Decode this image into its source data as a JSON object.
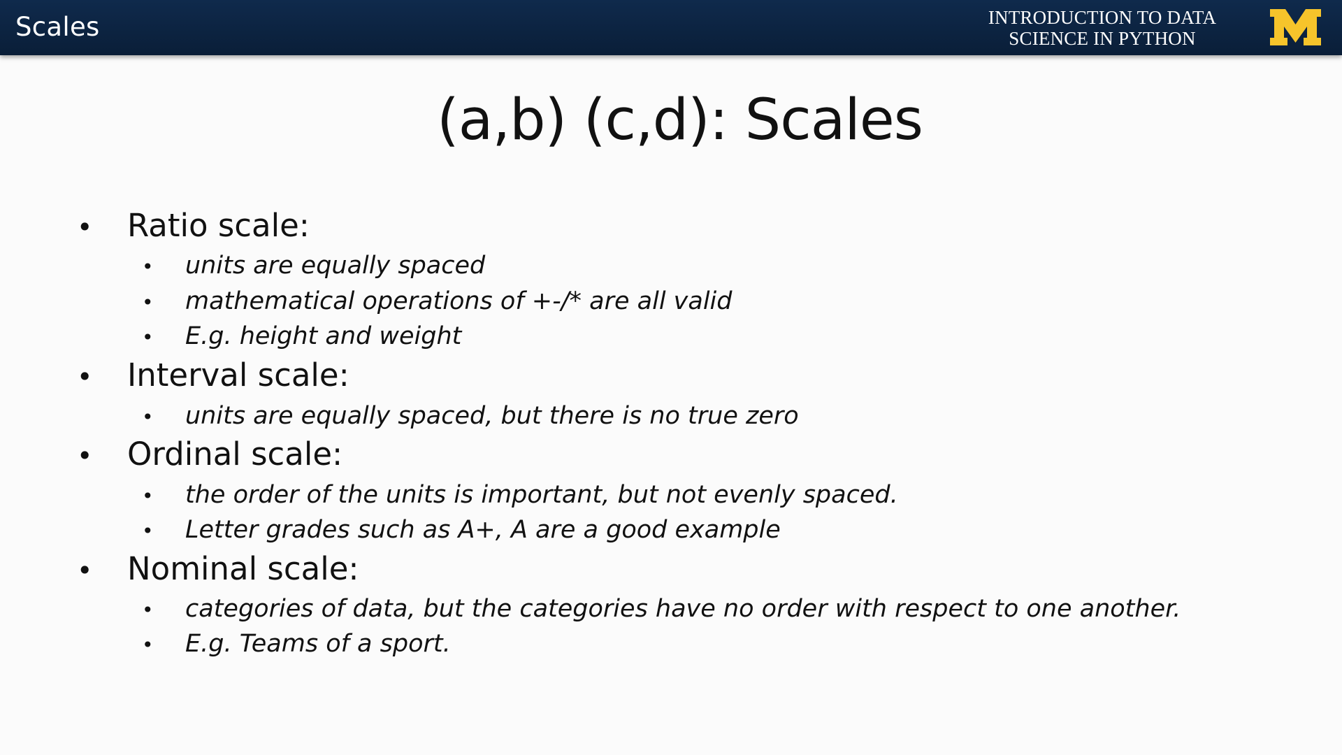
{
  "header": {
    "section_title": "Scales",
    "course_line1": "INTRODUCTION TO DATA",
    "course_line2": "SCIENCE  IN PYTHON",
    "logo_letter": "M",
    "bar_color": "#0f2a4c",
    "logo_color": "#f6c42b"
  },
  "slide": {
    "title": "(a,b) (c,d): Scales"
  },
  "bullet_glyph": "•",
  "bullets": [
    {
      "heading": "Ratio scale:",
      "items": [
        "units are equally spaced",
        "mathematical operations of +-/* are all valid",
        "E.g. height and weight"
      ]
    },
    {
      "heading": "Interval scale:",
      "items": [
        "units are equally spaced, but there is no true zero"
      ]
    },
    {
      "heading": "Ordinal scale:",
      "items": [
        "the order of the units is important, but not evenly spaced.",
        "Letter grades such as A+, A are a good example"
      ]
    },
    {
      "heading": "Nominal scale:",
      "items": [
        "categories of data, but the categories have no order with respect to one another.",
        "E.g. Teams of a sport."
      ]
    }
  ]
}
